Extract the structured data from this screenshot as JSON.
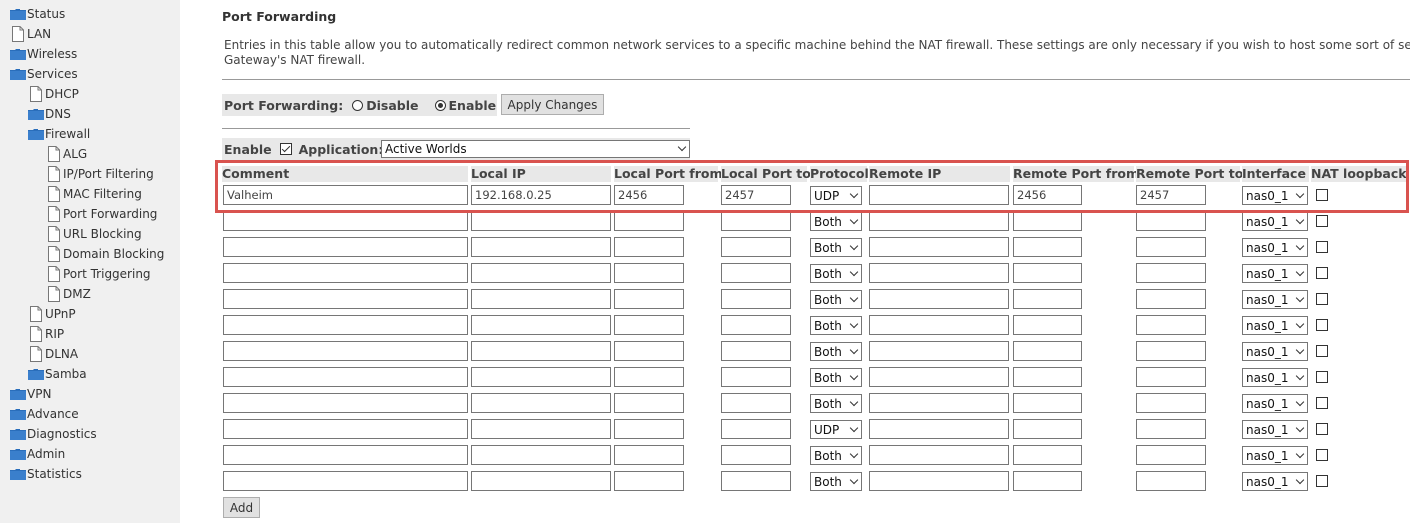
{
  "sidebar": {
    "items": [
      {
        "label": "Status",
        "icon": "folder-icon"
      },
      {
        "label": "LAN",
        "icon": "page-icon"
      },
      {
        "label": "Wireless",
        "icon": "folder-icon"
      },
      {
        "label": "Services",
        "icon": "folder-icon"
      },
      {
        "label": "DHCP",
        "icon": "page-icon"
      },
      {
        "label": "DNS",
        "icon": "folder-icon"
      },
      {
        "label": "Firewall",
        "icon": "folder-icon"
      },
      {
        "label": "ALG",
        "icon": "page-icon"
      },
      {
        "label": "IP/Port Filtering",
        "icon": "page-icon"
      },
      {
        "label": "MAC Filtering",
        "icon": "page-icon"
      },
      {
        "label": "Port Forwarding",
        "icon": "page-icon"
      },
      {
        "label": "URL Blocking",
        "icon": "page-icon"
      },
      {
        "label": "Domain Blocking",
        "icon": "page-icon"
      },
      {
        "label": "Port Triggering",
        "icon": "page-icon"
      },
      {
        "label": "DMZ",
        "icon": "page-icon"
      },
      {
        "label": "UPnP",
        "icon": "page-icon"
      },
      {
        "label": "RIP",
        "icon": "page-icon"
      },
      {
        "label": "DLNA",
        "icon": "page-icon"
      },
      {
        "label": "Samba",
        "icon": "folder-icon"
      },
      {
        "label": "VPN",
        "icon": "folder-icon"
      },
      {
        "label": "Advance",
        "icon": "folder-icon"
      },
      {
        "label": "Diagnostics",
        "icon": "folder-icon"
      },
      {
        "label": "Admin",
        "icon": "folder-icon"
      },
      {
        "label": "Statistics",
        "icon": "folder-icon"
      }
    ]
  },
  "page": {
    "title": "Port Forwarding",
    "intro_line1": "Entries in this table allow you to automatically redirect common network services to a specific machine behind the NAT firewall. These settings are only necessary if you wish to host some sort of server like a",
    "intro_line2": "Gateway's NAT firewall."
  },
  "mode": {
    "label": "Port Forwarding:",
    "disable_label": "Disable",
    "enable_label": "Enable",
    "selected": "Enable",
    "apply_label": "Apply Changes"
  },
  "app_row": {
    "enable_label": "Enable",
    "enable_checked": true,
    "application_label": "Application:",
    "application_value": "Active Worlds"
  },
  "table": {
    "headers": {
      "comment": "Comment",
      "local_ip": "Local IP",
      "local_port_from": "Local Port from",
      "local_port_to": "Local Port to",
      "protocol": "Protocol",
      "remote_ip": "Remote IP",
      "remote_port_from": "Remote Port from",
      "remote_port_to": "Remote Port to",
      "interface": "Interface",
      "nat_loopback": "NAT loopback"
    },
    "rows": [
      {
        "comment": "Valheim",
        "local_ip": "192.168.0.25",
        "lpf": "2456",
        "lpt": "2457",
        "protocol": "UDP",
        "remote_ip": "",
        "rpf": "2456",
        "rpt": "2457",
        "iface": "nas0_1"
      },
      {
        "comment": "",
        "local_ip": "",
        "lpf": "",
        "lpt": "",
        "protocol": "Both",
        "remote_ip": "",
        "rpf": "",
        "rpt": "",
        "iface": "nas0_1"
      },
      {
        "comment": "",
        "local_ip": "",
        "lpf": "",
        "lpt": "",
        "protocol": "Both",
        "remote_ip": "",
        "rpf": "",
        "rpt": "",
        "iface": "nas0_1"
      },
      {
        "comment": "",
        "local_ip": "",
        "lpf": "",
        "lpt": "",
        "protocol": "Both",
        "remote_ip": "",
        "rpf": "",
        "rpt": "",
        "iface": "nas0_1"
      },
      {
        "comment": "",
        "local_ip": "",
        "lpf": "",
        "lpt": "",
        "protocol": "Both",
        "remote_ip": "",
        "rpf": "",
        "rpt": "",
        "iface": "nas0_1"
      },
      {
        "comment": "",
        "local_ip": "",
        "lpf": "",
        "lpt": "",
        "protocol": "Both",
        "remote_ip": "",
        "rpf": "",
        "rpt": "",
        "iface": "nas0_1"
      },
      {
        "comment": "",
        "local_ip": "",
        "lpf": "",
        "lpt": "",
        "protocol": "Both",
        "remote_ip": "",
        "rpf": "",
        "rpt": "",
        "iface": "nas0_1"
      },
      {
        "comment": "",
        "local_ip": "",
        "lpf": "",
        "lpt": "",
        "protocol": "Both",
        "remote_ip": "",
        "rpf": "",
        "rpt": "",
        "iface": "nas0_1"
      },
      {
        "comment": "",
        "local_ip": "",
        "lpf": "",
        "lpt": "",
        "protocol": "Both",
        "remote_ip": "",
        "rpf": "",
        "rpt": "",
        "iface": "nas0_1"
      },
      {
        "comment": "",
        "local_ip": "",
        "lpf": "",
        "lpt": "",
        "protocol": "UDP",
        "remote_ip": "",
        "rpf": "",
        "rpt": "",
        "iface": "nas0_1"
      },
      {
        "comment": "",
        "local_ip": "",
        "lpf": "",
        "lpt": "",
        "protocol": "Both",
        "remote_ip": "",
        "rpf": "",
        "rpt": "",
        "iface": "nas0_1"
      },
      {
        "comment": "",
        "local_ip": "",
        "lpf": "",
        "lpt": "",
        "protocol": "Both",
        "remote_ip": "",
        "rpf": "",
        "rpt": "",
        "iface": "nas0_1"
      }
    ]
  },
  "add_label": "Add",
  "colors": {
    "highlight": "#d9534f",
    "folder": "#2a6ebb",
    "sidebar_bg": "#f0f0f0",
    "header_bg": "#e8e8e8"
  }
}
